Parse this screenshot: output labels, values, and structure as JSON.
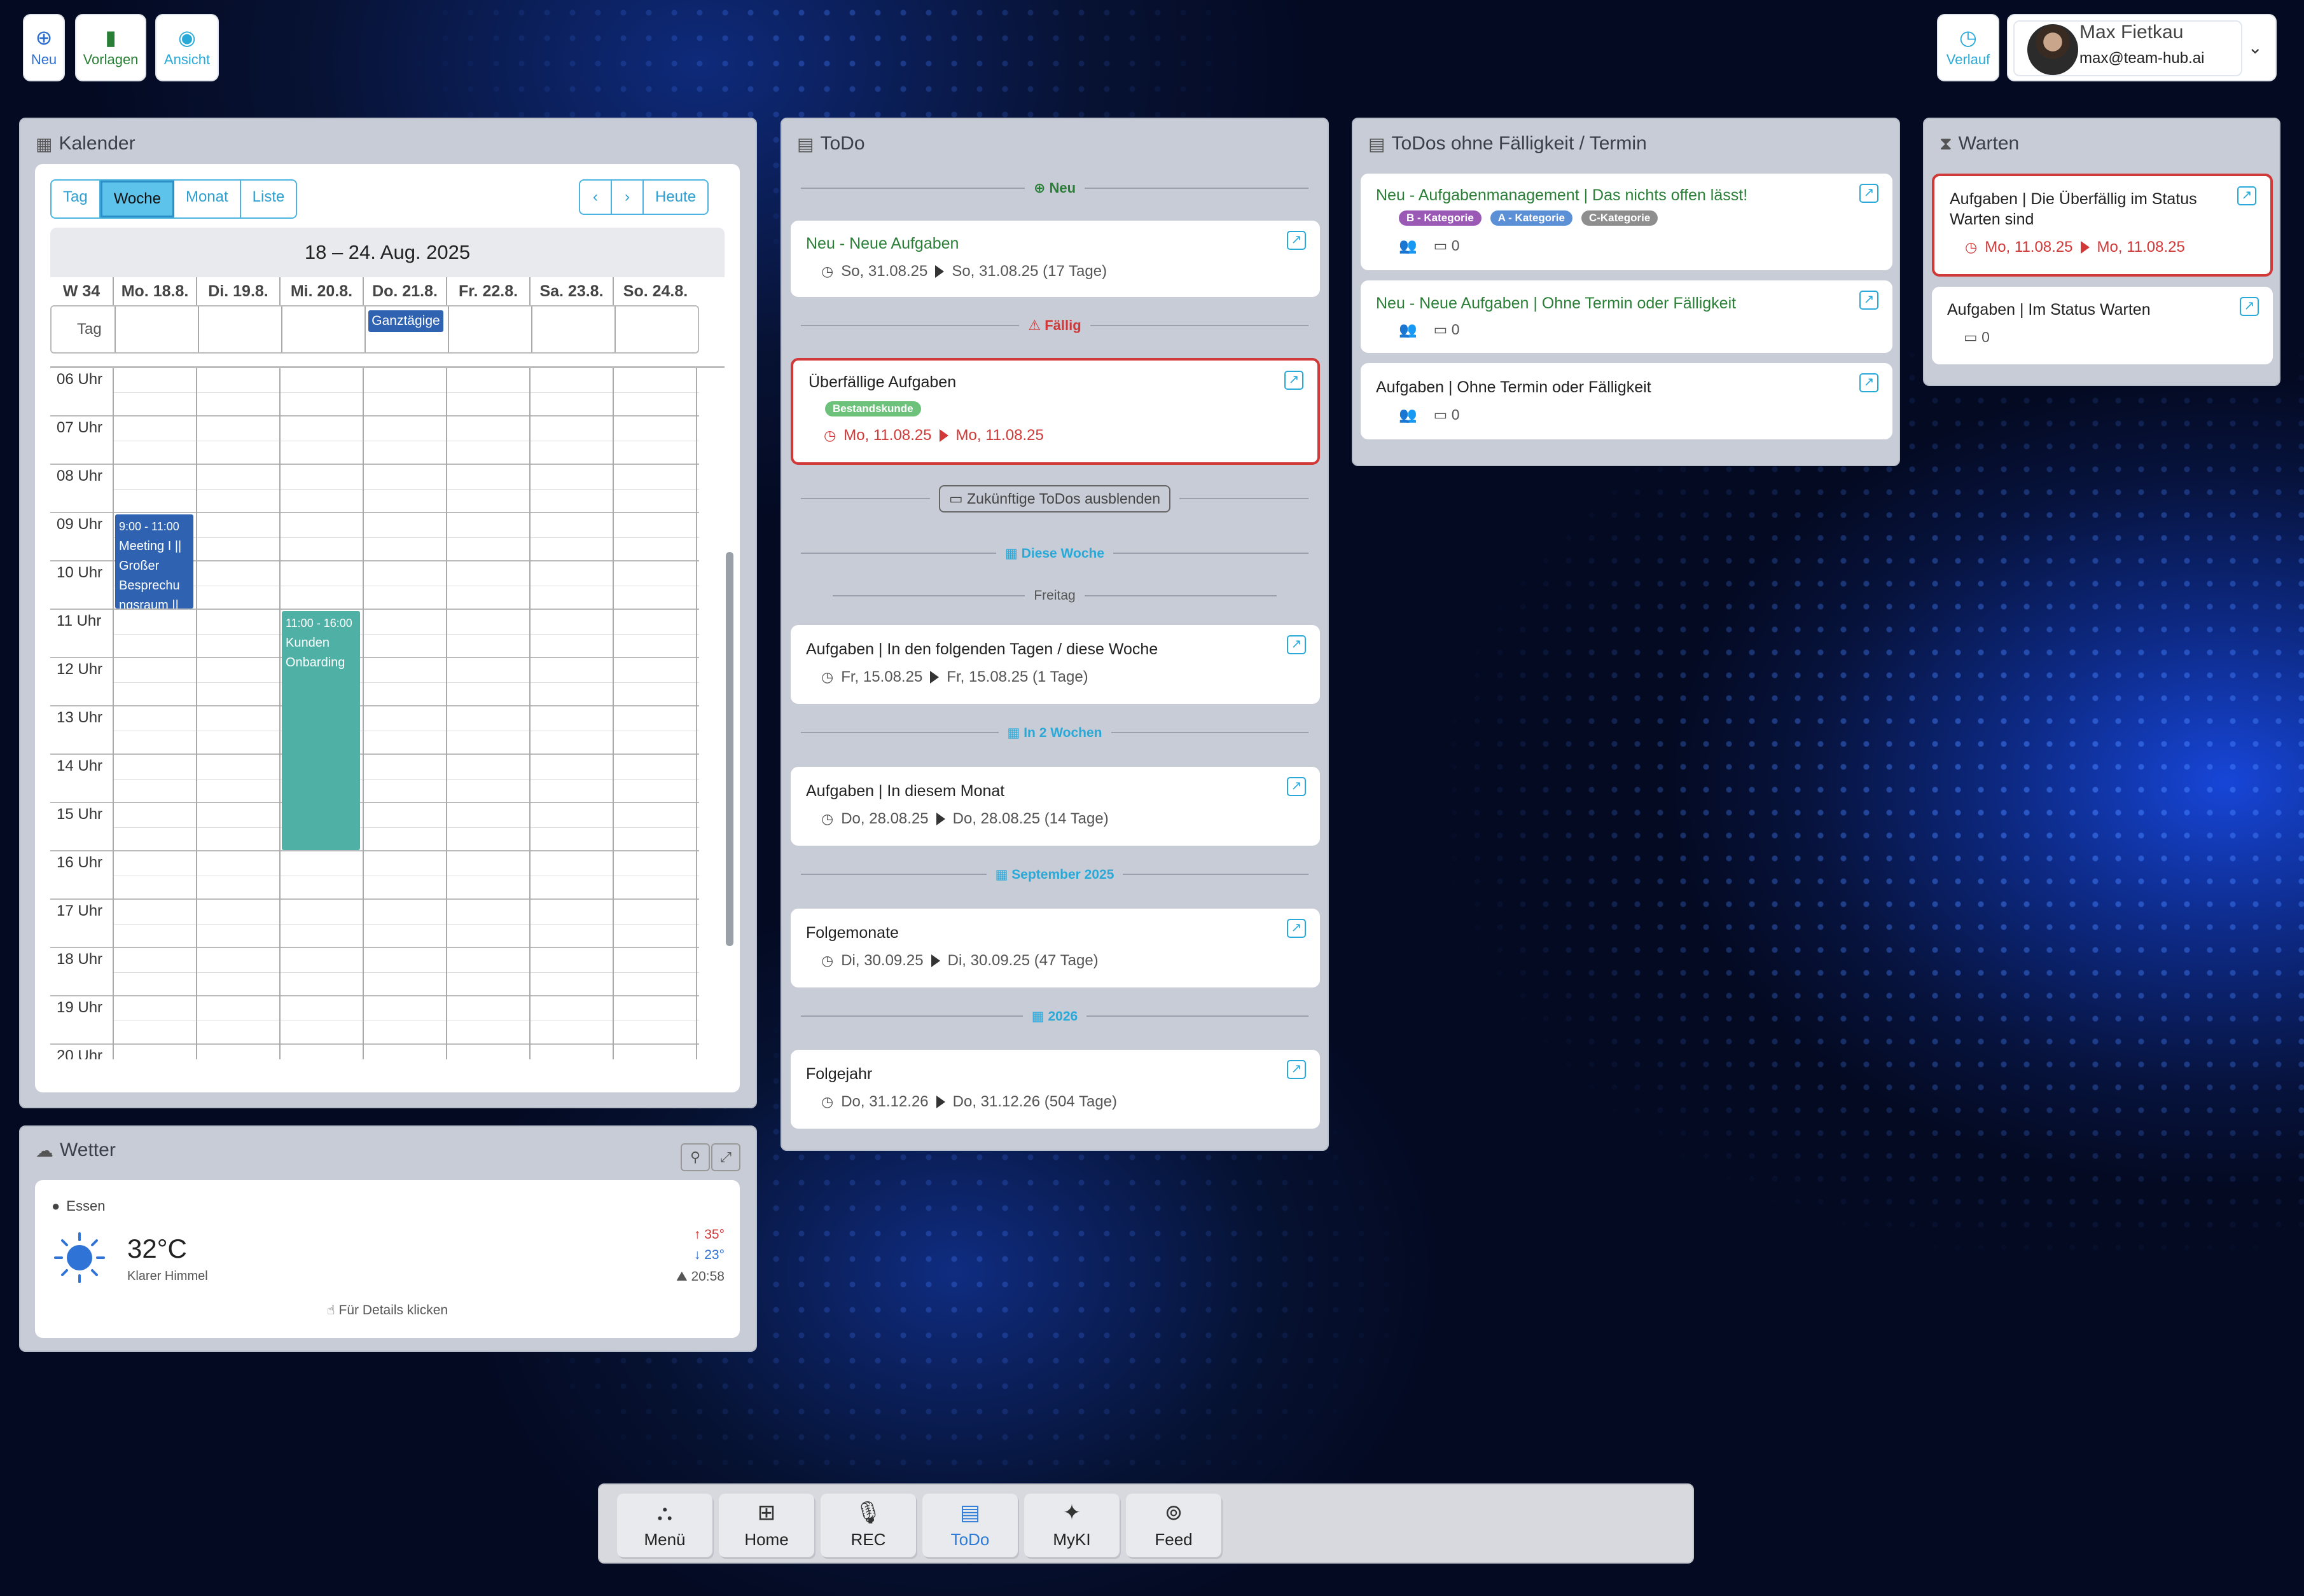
{
  "toolbar": {
    "new_label": "Neu",
    "templates_label": "Vorlagen",
    "view_label": "Ansicht",
    "history_label": "Verlauf"
  },
  "user": {
    "name": "Max Fietkau",
    "email": "max@team-hub.ai"
  },
  "calendar": {
    "title": "Kalender",
    "views": [
      "Tag",
      "Woche",
      "Monat",
      "Liste"
    ],
    "active_view": "Woche",
    "today_label": "Heute",
    "range": "18 – 24. Aug. 2025",
    "week_label": "W 34",
    "days": [
      "Mo. 18.8.",
      "Di. 19.8.",
      "Mi. 20.8.",
      "Do. 21.8.",
      "Fr. 22.8.",
      "Sa. 23.8.",
      "So. 24.8."
    ],
    "allday_label": "Tag",
    "allday_event": "Ganztägige",
    "hours": [
      "06 Uhr",
      "07 Uhr",
      "08 Uhr",
      "09 Uhr",
      "10 Uhr",
      "11 Uhr",
      "12 Uhr",
      "13 Uhr",
      "14 Uhr",
      "15 Uhr",
      "16 Uhr",
      "17 Uhr",
      "18 Uhr",
      "19 Uhr",
      "20 Uhr"
    ],
    "events": [
      {
        "time": "9:00 - 11:00",
        "text": "Meeting I || Großer Besprechu ngsraum ||",
        "day": 0,
        "start": 9,
        "end": 11,
        "color": "#2f63b2"
      },
      {
        "time": "11:00 - 16:00",
        "text": "Kunden Onbarding",
        "day": 2,
        "start": 11,
        "end": 16,
        "color": "#4fb1a6"
      }
    ]
  },
  "weather": {
    "title": "Wetter",
    "location": "Essen",
    "temp": "32°C",
    "condition": "Klarer Himmel",
    "high": "35°",
    "low": "23°",
    "sunset": "20:58",
    "details": "Für Details klicken"
  },
  "todo": {
    "title": "ToDo",
    "sep_new": "Neu",
    "new_card": {
      "title": "Neu - Neue Aufgaben",
      "from": "So, 31.08.25",
      "to": "So, 31.08.25 (17 Tage)"
    },
    "sep_due": "Fällig",
    "overdue_card": {
      "title": "Überfällige Aufgaben",
      "tag": "Bestandskunde",
      "from": "Mo, 11.08.25",
      "to": "Mo, 11.08.25"
    },
    "hide_future": "Zukünftige ToDos ausblenden",
    "sep_this_week": "Diese Woche",
    "sep_friday": "Freitag",
    "week_card": {
      "title": "Aufgaben | In den folgenden Tagen / diese Woche",
      "from": "Fr, 15.08.25",
      "to": "Fr, 15.08.25 (1 Tage)"
    },
    "sep_two_weeks": "In 2 Wochen",
    "month_card": {
      "title": "Aufgaben | In diesem Monat",
      "from": "Do, 28.08.25",
      "to": "Do, 28.08.25 (14 Tage)"
    },
    "sep_september": "September 2025",
    "next_month_card": {
      "title": "Folgemonate",
      "from": "Di, 30.09.25",
      "to": "Di, 30.09.25 (47 Tage)"
    },
    "sep_2026": "2026",
    "next_year_card": {
      "title": "Folgejahr",
      "from": "Do, 31.12.26",
      "to": "Do, 31.12.26 (504 Tage)"
    }
  },
  "nodue": {
    "title": "ToDos ohne Fälligkeit / Termin",
    "cards": [
      {
        "title": "Neu - Aufgabenmanagement | Das nichts offen lässt!",
        "tags": [
          "B - Kategorie",
          "A - Kategorie",
          "C-Kategorie"
        ],
        "count": "0"
      },
      {
        "title": "Neu - Neue Aufgaben | Ohne Termin oder Fälligkeit",
        "count": "0"
      },
      {
        "title": "Aufgaben | Ohne Termin oder Fälligkeit",
        "count": "0"
      }
    ]
  },
  "waiting": {
    "title": "Warten",
    "cards": [
      {
        "title": "Aufgaben | Die Überfällig im Status Warten sind",
        "from": "Mo, 11.08.25",
        "to": "Mo, 11.08.25"
      },
      {
        "title": "Aufgaben | Im Status Warten",
        "count": "0"
      }
    ]
  },
  "nav": {
    "items": [
      "Menü",
      "Home",
      "REC",
      "ToDo",
      "MyKI",
      "Feed"
    ],
    "active": "ToDo"
  },
  "colors": {
    "accent": "#29a9d8",
    "green": "#2a7f36",
    "red": "#d13838",
    "tag_b": "#9b59b6",
    "tag_a": "#5b8fd6",
    "tag_c": "#8e8e8e",
    "tag_bestand": "#6cc27a"
  }
}
